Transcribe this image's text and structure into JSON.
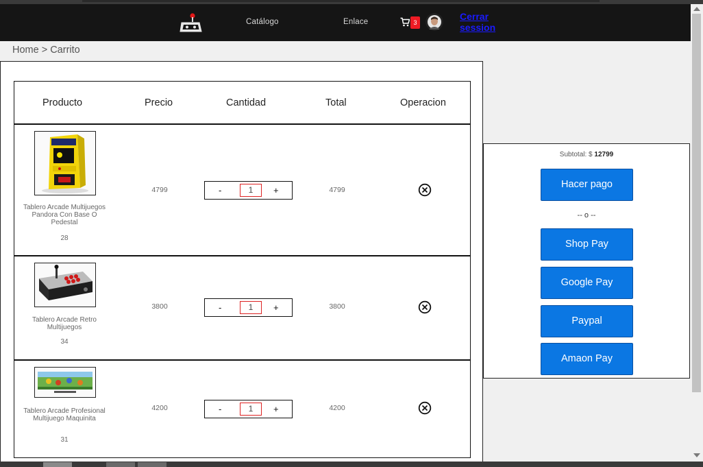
{
  "nav": {
    "logo_icon": "arcade-joystick-icon",
    "links": [
      "Catálogo",
      "Enlace"
    ],
    "cart_icon": "cart-icon",
    "cart_count": "3",
    "logout_label": "Cerrar session"
  },
  "breadcrumb": "Home > Carrito",
  "table": {
    "headers": [
      "Producto",
      "Precio",
      "Cantidad",
      "Total",
      "Operacion"
    ],
    "rows": [
      {
        "name": "Tablero Arcade Multijuegos Pandora Con Base O Pedestal",
        "stock": "28",
        "price": "4799",
        "qty": "1",
        "total": "4799",
        "minus": "-",
        "plus": "+"
      },
      {
        "name": "Tablero Arcade Retro Multijuegos",
        "stock": "34",
        "price": "3800",
        "qty": "1",
        "total": "3800",
        "minus": "-",
        "plus": "+"
      },
      {
        "name": "Tablero Arcade Profesional Multijuego Maquinita",
        "stock": "31",
        "price": "4200",
        "qty": "1",
        "total": "4200",
        "minus": "-",
        "plus": "+"
      }
    ],
    "remove_icon": "close-circle-icon"
  },
  "summary": {
    "subtotal_label": "Subtotal: $",
    "subtotal_value": "12799",
    "pay_button": "Hacer pago",
    "or_text": "-- o --",
    "payment_options": [
      "Shop Pay",
      "Google Pay",
      "Paypal",
      "Amaon Pay"
    ]
  },
  "colors": {
    "navbar": "#151515",
    "button": "#0b77e3",
    "badge": "#ee1b24",
    "link": "#1a1aff"
  }
}
